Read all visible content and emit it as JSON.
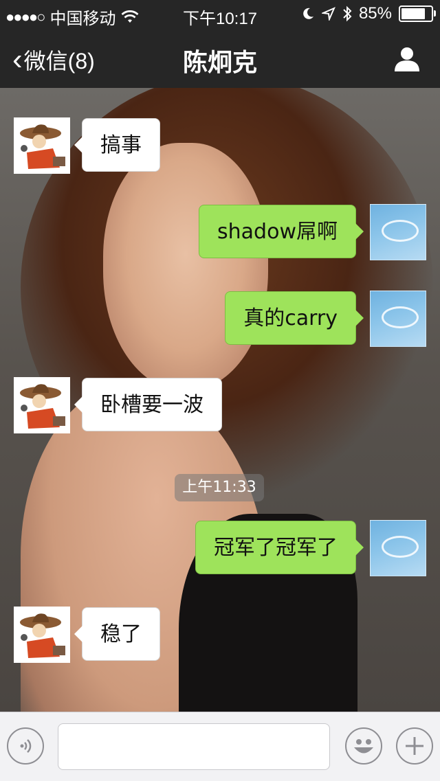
{
  "status_bar": {
    "signal_dots": "●●●●○",
    "carrier": "中国移动",
    "time": "下午10:17",
    "battery": "85%",
    "battery_level": 0.85
  },
  "nav": {
    "back_label": "微信(8)",
    "title": "陈炯克"
  },
  "messages": [
    {
      "side": "left",
      "text": "搞事"
    },
    {
      "side": "right",
      "text": "shadow屌啊"
    },
    {
      "side": "right",
      "text": "真的carry"
    },
    {
      "side": "left",
      "text": "卧槽要一波"
    },
    {
      "side": "right",
      "text": "冠军了冠军了"
    },
    {
      "side": "left",
      "text": "稳了"
    }
  ],
  "timestamp": "上午11:33",
  "colors": {
    "bar_background": "#262626",
    "bubble_sent": "#9ee35b",
    "bubble_received": "#ffffff"
  },
  "icons": {
    "wifi": "wifi-icon",
    "moon": "moon-icon",
    "location": "location-arrow-icon",
    "bluetooth": "bluetooth-icon",
    "profile": "person-icon",
    "voice": "voice-icon",
    "emoji": "emoji-icon",
    "plus": "plus-icon"
  }
}
